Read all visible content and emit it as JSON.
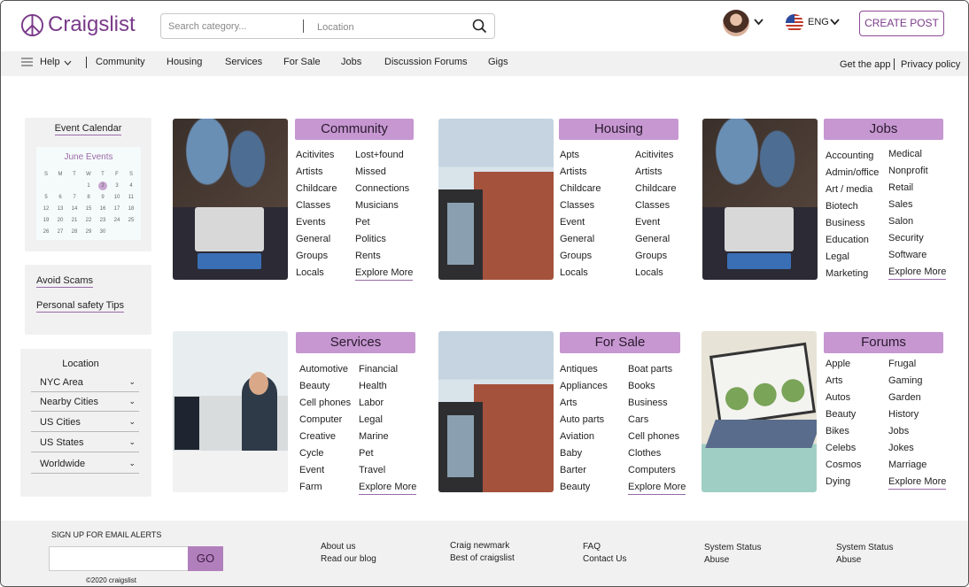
{
  "header": {
    "logo": "Craigslist",
    "search_placeholder": "Search category...",
    "location_placeholder": "Location",
    "language": "ENG",
    "create_post": "CREATE POST"
  },
  "nav": {
    "help": "Help",
    "links": [
      "Community",
      "Housing",
      "Services",
      "For Sale",
      "Jobs",
      "Discussion Forums",
      "Gigs"
    ],
    "get_app": "Get the app",
    "privacy": "Privacy policy"
  },
  "sidebar": {
    "event_calendar": "Event Calendar",
    "calendar_title": "June Events",
    "weekdays": [
      "S",
      "M",
      "T",
      "W",
      "T",
      "F",
      "S"
    ],
    "days": [
      "",
      "",
      "",
      "1",
      "2",
      "3",
      "4",
      "5",
      "6",
      "7",
      "8",
      "9",
      "10",
      "11",
      "12",
      "13",
      "14",
      "15",
      "16",
      "17",
      "18",
      "19",
      "20",
      "21",
      "22",
      "23",
      "24",
      "25",
      "26",
      "27",
      "28",
      "29",
      "30",
      "",
      ""
    ],
    "highlight_day": "2",
    "safety": [
      "Avoid Scams",
      "Personal safety Tips"
    ],
    "location_title": "Location",
    "locations": [
      "NYC Area",
      "Nearby Cities",
      "US Cities",
      "US States",
      "Worldwide"
    ]
  },
  "cards": {
    "community": {
      "title": "Community",
      "col1": [
        "Acitivites",
        "Artists",
        "Childcare",
        "Classes",
        "Events",
        "General",
        "Groups",
        "Locals"
      ],
      "col2": [
        "Lost+found",
        "Missed",
        "Connections",
        "Musicians",
        "Pet",
        "Politics",
        "Rents"
      ],
      "more": "Explore More"
    },
    "housing": {
      "title": "Housing",
      "col1": [
        "Apts",
        "Artists",
        "Childcare",
        "Classes",
        "Event",
        "General",
        "Groups",
        "Locals"
      ],
      "col2": [
        "Acitivites",
        "Artists",
        "Childcare",
        "Classes",
        "Event",
        "General",
        "Groups",
        "Locals"
      ]
    },
    "jobs": {
      "title": "Jobs",
      "col1": [
        "Accounting",
        "Admin/office",
        "Art / media",
        "Biotech",
        "Business",
        "Education",
        "Legal",
        "Marketing"
      ],
      "col2": [
        "Medical",
        "Nonprofit",
        "Retail",
        "Sales",
        "Salon",
        "Security",
        "Software"
      ],
      "more": "Explore More"
    },
    "services": {
      "title": "Services",
      "col1": [
        "Automotive",
        "Beauty",
        "Cell phones",
        "Computer",
        "Creative",
        "Cycle",
        "Event",
        "Farm"
      ],
      "col2": [
        "Financial",
        "Health",
        "Labor",
        "Legal",
        "Marine",
        "Pet",
        "Travel"
      ],
      "more": "Explore More"
    },
    "forsale": {
      "title": "For Sale",
      "col1": [
        "Antiques",
        "Appliances",
        "Arts",
        "Auto parts",
        "Aviation",
        "Baby",
        "Barter",
        "Beauty"
      ],
      "col2": [
        "Boat parts",
        "Books",
        "Business",
        "Cars",
        "Cell phones",
        "Clothes",
        "Computers"
      ],
      "more": "Explore More"
    },
    "forums": {
      "title": "Forums",
      "col1": [
        "Apple",
        "Arts",
        "Autos",
        "Beauty",
        "Bikes",
        "Celebs",
        "Cosmos",
        "Dying"
      ],
      "col2": [
        "Frugal",
        "Gaming",
        "Garden",
        "History",
        "Jobs",
        "Jokes",
        "Marriage"
      ],
      "more": "Explore More"
    }
  },
  "footer": {
    "signup": "SIGN UP  FOR EMAIL ALERTS",
    "go": "GO",
    "copyright": "©2020 craigslist",
    "links": [
      [
        "About us",
        "Read our blog"
      ],
      [
        "Craig newmark",
        "Best of craigslist"
      ],
      [
        "FAQ",
        "Contact  Us"
      ],
      [
        "System Status",
        "Abuse"
      ],
      [
        "System Status",
        "Abuse"
      ]
    ]
  },
  "colors": {
    "brand": "#7a3a8a",
    "accent": "#c697d1",
    "panel": "#f1f1f1"
  },
  "icons": [
    "peace-icon",
    "search-icon",
    "chevron-down-icon",
    "menu-icon",
    "us-flag-icon"
  ]
}
